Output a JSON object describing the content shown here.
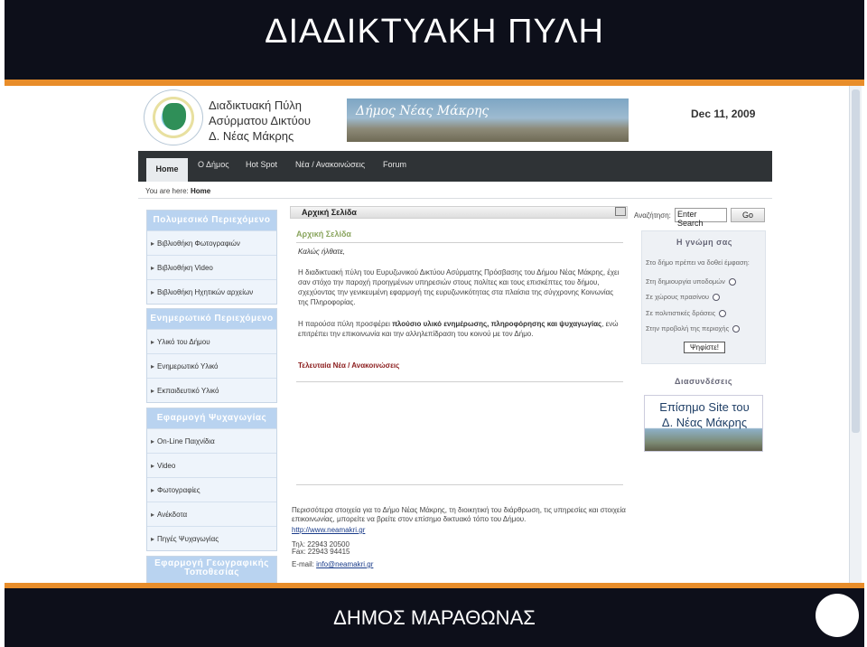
{
  "slide": {
    "title": "ΔΙΑΔΙΚΤΥΑΚΗ ΠΥΛΗ",
    "footer": "ΔΗΜΟΣ ΜΑΡΑΘΩΝΑΣ"
  },
  "header": {
    "portal_line1": "Διαδικτυακή Πύλη",
    "portal_line2": "Ασύρματου Δικτύου",
    "portal_line3": "Δ. Νέας Μάκρης",
    "banner_text": "Δήμος Νέας Μάκρης",
    "date": "Dec 11, 2009"
  },
  "nav": {
    "items": [
      "Home",
      "Ο Δήμος",
      "Hot Spot",
      "Νέα / Ανακοινώσεις",
      "Forum"
    ]
  },
  "breadcrumb": {
    "prefix": "You are here:",
    "current": "Home"
  },
  "sidebar": {
    "boxes": [
      {
        "title": "Πολυμεσικό Περιεχόμενο",
        "items": [
          "Βιβλιοθήκη Φωτογραφιών",
          "Βιβλιοθήκη Video",
          "Βιβλιοθήκη Ηχητικών αρχείων"
        ]
      },
      {
        "title": "Ενημερωτικό Περιεχόμενο",
        "items": [
          "Υλικό του Δήμου",
          "Ενημερωτικό Υλικό",
          "Εκπαιδευτικό Υλικό"
        ]
      },
      {
        "title": "Εφαρμογή Ψυχαγωγίας",
        "items": [
          "On-Line Παιχνίδια",
          "Video",
          "Φωτογραφίες",
          "Ανέκδοτα",
          "Πηγές Ψυχαγωγίας"
        ]
      },
      {
        "title": "Εφαρμογή Γεωγραφικής Τοποθεσίας",
        "items": []
      }
    ]
  },
  "main": {
    "head": "Αρχική Σελίδα",
    "sub": "Αρχική Σελίδα",
    "welcome": "Καλώς ήλθατε,",
    "para1": "Η διαδικτυακή πύλη του Ευρυζωνικού Δικτύου Ασύρματης Πρόσβασης του Δήμου Νέας Μάκρης, έχει σαν στόχο την παροχή προηγμένων υπηρεσιών στους πολίτες και τους επισκέπτες του δήμου, σχεχύοντας την γενικευμένη εφαρμογή της ευρυζωνικότητας στα πλαίσια της σύγχρονης Κοινωνίας της Πληροφορίας.",
    "para2_pre": "Η παρούσα πύλη προσφέρει ",
    "para2_bold": "πλούσιο υλικό ενημέρωσης, πληροφόρησης και ψυχαγωγίας",
    "para2_post": ", ενώ επιτρέπει την επικοινωνία και την αλληλεπίδραση του κοινού με τον Δήμο.",
    "news_link": "Τελευταία Νέα / Ανακοινώσεις",
    "footer_info": "Περισσότερα στοιχεία για το Δήμο Νέας Μάκρης, τη διοικητική του διάρθρωση, τις υπηρεσίες και στοιχεία επικοινωνίας, μπορείτε να βρείτε στον επίσημο δικτυακό τόπο του Δήμου.",
    "website": "http://www.neamakri.gr",
    "phone": "Τηλ: 22943 20500",
    "fax": "Fax: 22943 94415",
    "email_label": "E-mail:",
    "email": "info@neamakri.gr"
  },
  "right": {
    "search_label": "Αναζήτηση:",
    "search_value": "Enter Search",
    "go_label": "Go",
    "poll_title": "Η γνώμη σας",
    "poll_question": "Στο δήμο πρέπει να δοθεί έμφαση:",
    "poll_options": [
      "Στη δημιουργία υποδομών",
      "Σε χώρους πρασίνου",
      "Σε πολιτιστικές δράσεις",
      "Στην προβολή της περιοχής"
    ],
    "vote_label": "Ψηφίστε!",
    "links_title": "Διασυνδέσεις",
    "official_line1": "Επίσημο Site του",
    "official_line2": "Δ. Νέας Μάκρης"
  }
}
